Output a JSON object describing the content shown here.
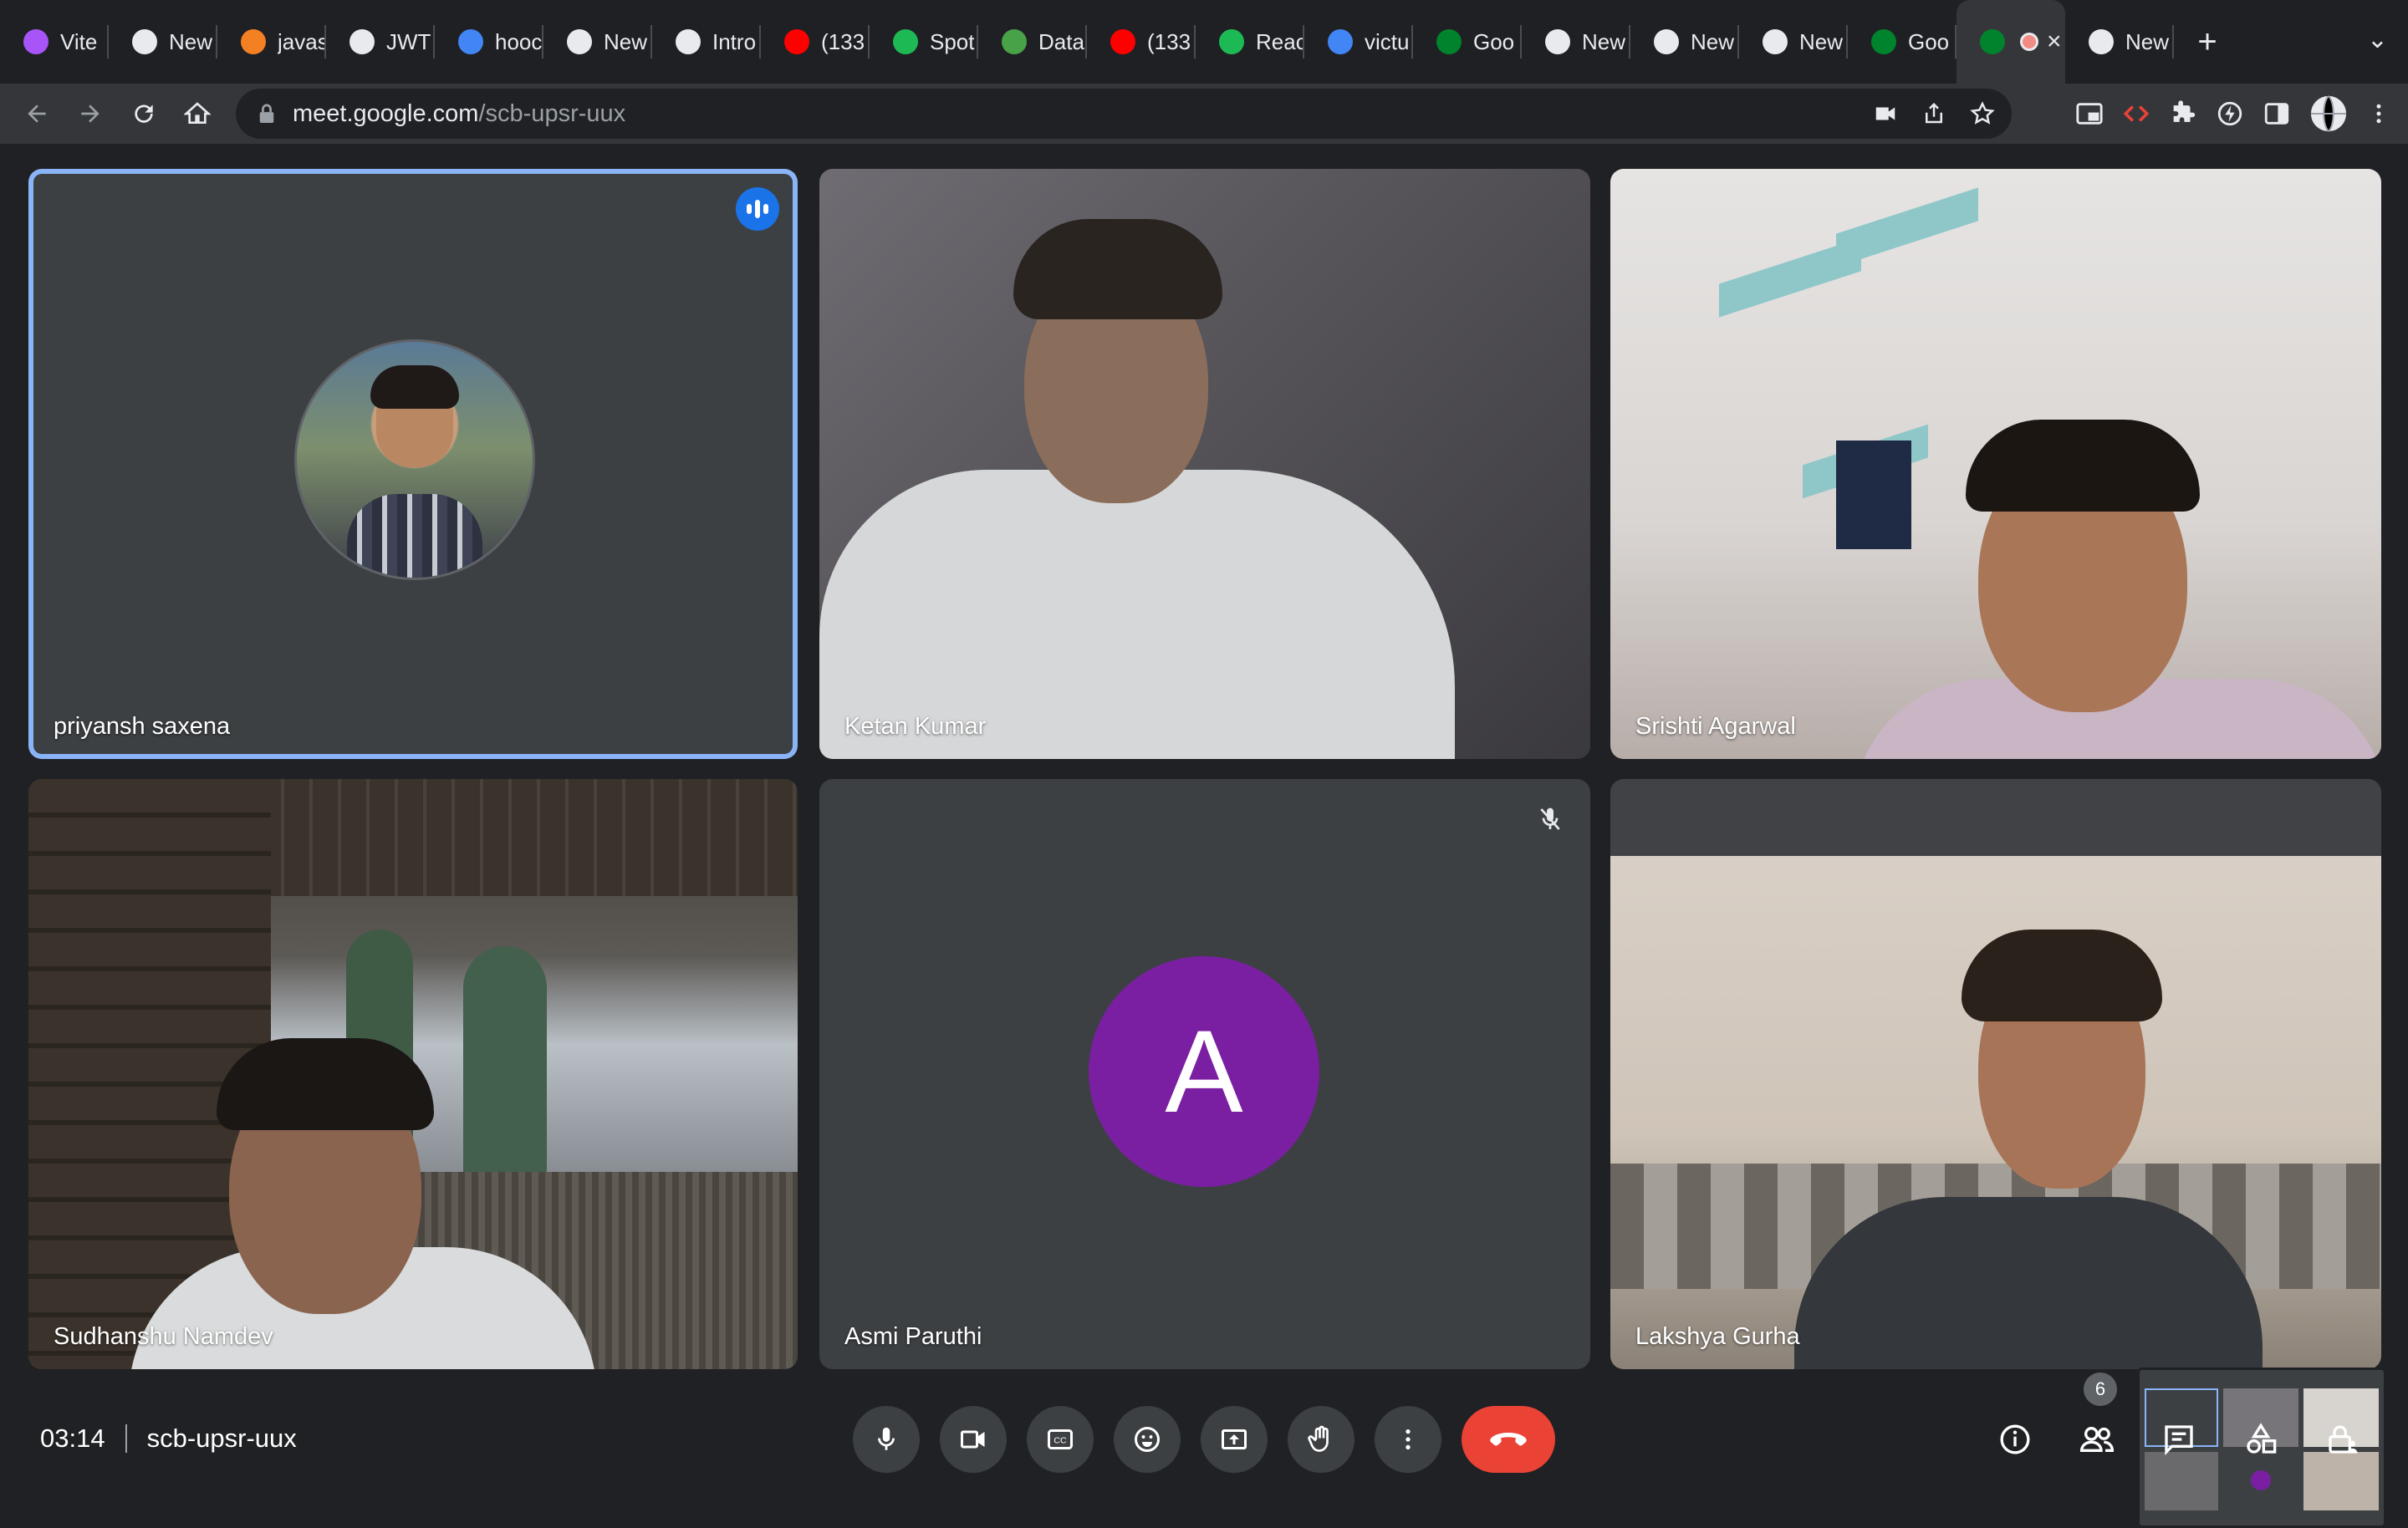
{
  "browser": {
    "tabs": [
      {
        "title": "Vite",
        "icon": "vite-icon",
        "color": "#a855f7"
      },
      {
        "title": "New",
        "icon": "chrome-icon",
        "color": "#e8eaed"
      },
      {
        "title": "javas",
        "icon": "stackoverflow-icon",
        "color": "#f48024"
      },
      {
        "title": "JWT",
        "icon": "jwt-icon",
        "color": "#e8eaed"
      },
      {
        "title": "hooc",
        "icon": "google-icon",
        "color": "#4285f4"
      },
      {
        "title": "New",
        "icon": "chrome-icon",
        "color": "#e8eaed"
      },
      {
        "title": "Intro",
        "icon": "medium-icon",
        "color": "#e8eaed"
      },
      {
        "title": "(133",
        "icon": "youtube-icon",
        "color": "#ff0000"
      },
      {
        "title": "Spot",
        "icon": "spotify-icon",
        "color": "#1db954"
      },
      {
        "title": "Data",
        "icon": "mongodb-icon",
        "color": "#47a248"
      },
      {
        "title": "(133",
        "icon": "youtube-icon",
        "color": "#ff0000"
      },
      {
        "title": "Reac",
        "icon": "w-icon",
        "color": "#1db954"
      },
      {
        "title": "victu",
        "icon": "google-icon",
        "color": "#4285f4"
      },
      {
        "title": "Goo",
        "icon": "meet-icon",
        "color": "#00832d"
      },
      {
        "title": "New",
        "icon": "chrome-icon",
        "color": "#e8eaed"
      },
      {
        "title": "New",
        "icon": "chrome-icon",
        "color": "#e8eaed"
      },
      {
        "title": "New",
        "icon": "chrome-icon",
        "color": "#e8eaed"
      },
      {
        "title": "Goo",
        "icon": "meet-icon",
        "color": "#00832d"
      },
      {
        "title": "",
        "icon": "meet-icon",
        "color": "#00832d",
        "active": true
      },
      {
        "title": "New",
        "icon": "chrome-icon",
        "color": "#e8eaed"
      }
    ],
    "url_host": "meet.google.com",
    "url_path": "/scb-upsr-uux"
  },
  "meet": {
    "participants": [
      {
        "name": "priyansh saxena",
        "speaking": true,
        "avatar": "photo"
      },
      {
        "name": "Ketan Kumar",
        "video": true
      },
      {
        "name": "Srishti Agarwal",
        "video": true
      },
      {
        "name": "Sudhanshu Namdev",
        "video": true
      },
      {
        "name": "Asmi Paruthi",
        "muted": true,
        "avatar_letter": "A",
        "avatar_color": "#7b1fa2"
      },
      {
        "name": "Lakshya Gurha",
        "video": true
      }
    ],
    "time": "03:14",
    "meeting_code": "scb-upsr-uux",
    "people_count": "6",
    "end_call_color": "#ea4335",
    "accent": "#8ab4f8"
  }
}
